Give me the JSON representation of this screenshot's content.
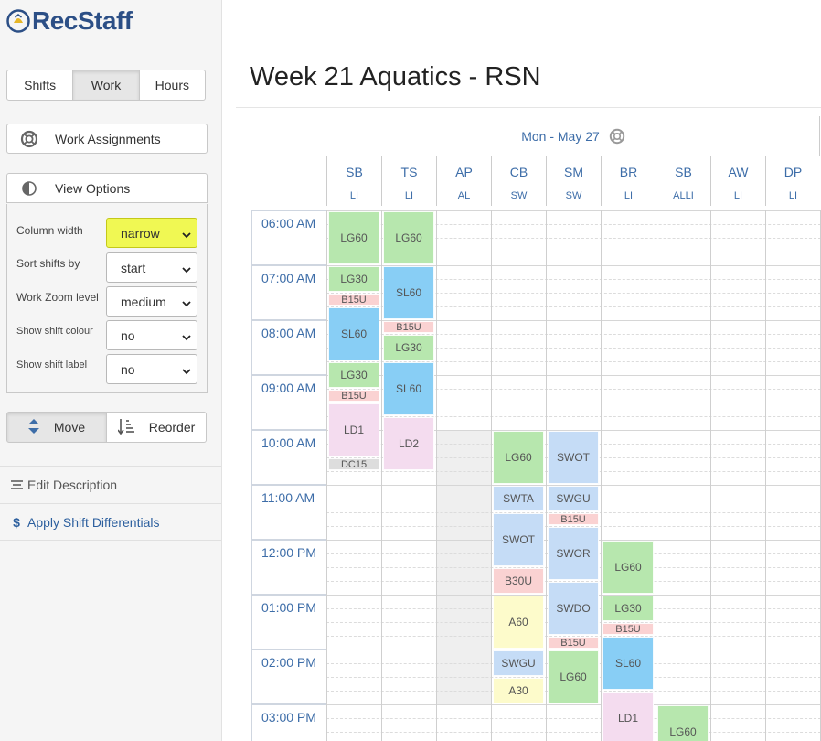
{
  "app": {
    "logo_text": "RecStaff"
  },
  "sidebar": {
    "tabs": [
      {
        "label": "Shifts",
        "active": false
      },
      {
        "label": "Work",
        "active": true
      },
      {
        "label": "Hours",
        "active": false
      }
    ],
    "work_assignments_label": "Work Assignments",
    "view_options_label": "View Options",
    "options": [
      {
        "label": "Column width",
        "value": "narrow",
        "highlighted": true
      },
      {
        "label": "Sort shifts by",
        "value": "start"
      },
      {
        "label": "Work Zoom level",
        "value": "medium"
      },
      {
        "label": "Show shift colour",
        "value": "no"
      },
      {
        "label": "Show shift label",
        "value": "no"
      }
    ],
    "move_label": "Move",
    "reorder_label": "Reorder",
    "edit_description_label": "Edit Description",
    "apply_diff_label": "Apply Shift Differentials"
  },
  "main": {
    "title": "Week 21 Aquatics - RSN",
    "day_label": "Mon - May 27",
    "columns": [
      {
        "name": "SB",
        "role": "LI"
      },
      {
        "name": "TS",
        "role": "LI"
      },
      {
        "name": "AP",
        "role": "AL"
      },
      {
        "name": "CB",
        "role": "SW"
      },
      {
        "name": "SM",
        "role": "SW"
      },
      {
        "name": "BR",
        "role": "LI"
      },
      {
        "name": "SB",
        "role": "ALLI"
      },
      {
        "name": "AW",
        "role": "LI"
      },
      {
        "name": "DP",
        "role": "LI"
      }
    ],
    "times": [
      "06:00 AM",
      "07:00 AM",
      "08:00 AM",
      "09:00 AM",
      "10:00 AM",
      "11:00 AM",
      "12:00 PM",
      "01:00 PM",
      "02:00 PM",
      "03:00 PM"
    ],
    "unavailable": [
      {
        "col": 2,
        "start_min": 240,
        "end_min": 540
      }
    ],
    "blocks": [
      {
        "col": 0,
        "start_min": 0,
        "end_min": 60,
        "label": "LG60",
        "color": "green"
      },
      {
        "col": 0,
        "start_min": 60,
        "end_min": 90,
        "label": "LG30",
        "color": "green"
      },
      {
        "col": 0,
        "start_min": 90,
        "end_min": 105,
        "label": "B15U",
        "color": "pink"
      },
      {
        "col": 0,
        "start_min": 105,
        "end_min": 165,
        "label": "SL60",
        "color": "blue"
      },
      {
        "col": 0,
        "start_min": 165,
        "end_min": 195,
        "label": "LG30",
        "color": "green"
      },
      {
        "col": 0,
        "start_min": 195,
        "end_min": 210,
        "label": "B15U",
        "color": "pink"
      },
      {
        "col": 0,
        "start_min": 210,
        "end_min": 270,
        "label": "LD1",
        "color": "lav"
      },
      {
        "col": 0,
        "start_min": 270,
        "end_min": 285,
        "label": "DC15",
        "color": "gray"
      },
      {
        "col": 1,
        "start_min": 0,
        "end_min": 60,
        "label": "LG60",
        "color": "green"
      },
      {
        "col": 1,
        "start_min": 60,
        "end_min": 120,
        "label": "SL60",
        "color": "blue"
      },
      {
        "col": 1,
        "start_min": 120,
        "end_min": 135,
        "label": "B15U",
        "color": "pink"
      },
      {
        "col": 1,
        "start_min": 135,
        "end_min": 165,
        "label": "LG30",
        "color": "green"
      },
      {
        "col": 1,
        "start_min": 165,
        "end_min": 225,
        "label": "SL60",
        "color": "blue"
      },
      {
        "col": 1,
        "start_min": 225,
        "end_min": 285,
        "label": "LD2",
        "color": "lav"
      },
      {
        "col": 3,
        "start_min": 240,
        "end_min": 300,
        "label": "LG60",
        "color": "green"
      },
      {
        "col": 3,
        "start_min": 300,
        "end_min": 330,
        "label": "SWTA",
        "color": "lblue"
      },
      {
        "col": 3,
        "start_min": 330,
        "end_min": 390,
        "label": "SWOT",
        "color": "lblue"
      },
      {
        "col": 3,
        "start_min": 390,
        "end_min": 420,
        "label": "B30U",
        "color": "pink"
      },
      {
        "col": 3,
        "start_min": 420,
        "end_min": 480,
        "label": "A60",
        "color": "yel"
      },
      {
        "col": 3,
        "start_min": 480,
        "end_min": 510,
        "label": "SWGU",
        "color": "lblue"
      },
      {
        "col": 3,
        "start_min": 510,
        "end_min": 540,
        "label": "A30",
        "color": "yel"
      },
      {
        "col": 4,
        "start_min": 240,
        "end_min": 300,
        "label": "SWOT",
        "color": "lblue"
      },
      {
        "col": 4,
        "start_min": 300,
        "end_min": 330,
        "label": "SWGU",
        "color": "lblue"
      },
      {
        "col": 4,
        "start_min": 330,
        "end_min": 345,
        "label": "B15U",
        "color": "pink"
      },
      {
        "col": 4,
        "start_min": 345,
        "end_min": 405,
        "label": "SWOR",
        "color": "lblue"
      },
      {
        "col": 4,
        "start_min": 405,
        "end_min": 465,
        "label": "SWDO",
        "color": "lblue"
      },
      {
        "col": 4,
        "start_min": 465,
        "end_min": 480,
        "label": "B15U",
        "color": "pink"
      },
      {
        "col": 4,
        "start_min": 480,
        "end_min": 540,
        "label": "LG60",
        "color": "green"
      },
      {
        "col": 5,
        "start_min": 360,
        "end_min": 420,
        "label": "LG60",
        "color": "green"
      },
      {
        "col": 5,
        "start_min": 420,
        "end_min": 450,
        "label": "LG30",
        "color": "green"
      },
      {
        "col": 5,
        "start_min": 450,
        "end_min": 465,
        "label": "B15U",
        "color": "pink"
      },
      {
        "col": 5,
        "start_min": 465,
        "end_min": 525,
        "label": "SL60",
        "color": "blue"
      },
      {
        "col": 5,
        "start_min": 525,
        "end_min": 585,
        "label": "LD1",
        "color": "lav"
      },
      {
        "col": 6,
        "start_min": 540,
        "end_min": 600,
        "label": "LG60",
        "color": "green"
      }
    ]
  },
  "colors": {
    "brand": "#2c4f86",
    "link": "#3d6da8",
    "highlight": "#f0f853",
    "green": "#b7e7ae",
    "blue": "#88cef5",
    "light_blue": "#c5dcf6",
    "pink": "#fad2d2",
    "lavender": "#f4dcef",
    "yellow": "#fdfbcb",
    "gray": "#dddddd"
  },
  "icons": [
    "logo-icon",
    "lifebuoy-icon",
    "half-circle-icon",
    "chevron-down-icon",
    "move-arrows-icon",
    "reorder-icon",
    "align-icon",
    "dollar-icon"
  ]
}
